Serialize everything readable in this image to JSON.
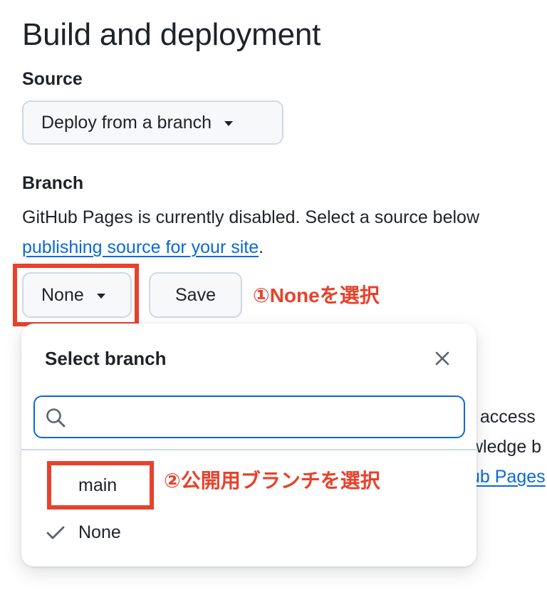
{
  "section": {
    "title": "Build and deployment",
    "source_label": "Source",
    "source_value": "Deploy from a branch",
    "branch_label": "Branch",
    "description_line1": "GitHub Pages is currently disabled. Select a source below",
    "description_link": "publishing source for your site",
    "description_end": "."
  },
  "branch_controls": {
    "selected_branch": "None",
    "save_label": "Save"
  },
  "annotations": {
    "step1": "①Noneを選択",
    "step2": "②公開用ブランチを選択",
    "highlight_color": "#e8412c"
  },
  "background_fragments": {
    "line1": "t access",
    "line2": "wledge b",
    "line3": "ub Pages"
  },
  "popover": {
    "title": "Select branch",
    "search_placeholder": "",
    "search_value": "",
    "options": [
      {
        "label": "main",
        "checked": false
      },
      {
        "label": "None",
        "checked": true
      }
    ]
  },
  "colors": {
    "link": "#0969da",
    "focus_border": "#0969da",
    "text": "#1f2328"
  }
}
